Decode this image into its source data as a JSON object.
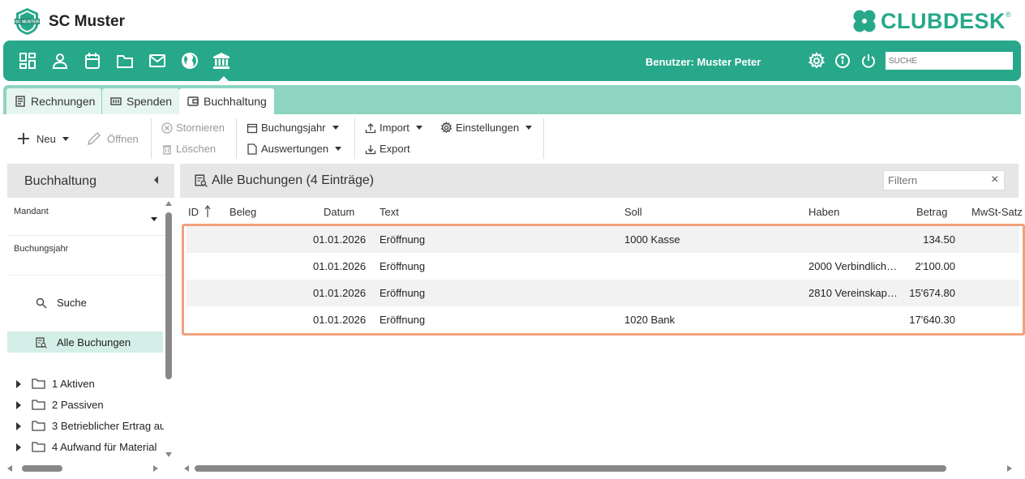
{
  "brand": {
    "club_name": "SC Muster",
    "badge_text": "SC MUSTER",
    "product_name": "CLUBDESK",
    "product_mark": "®",
    "accent_color": "#27a88a"
  },
  "navbar": {
    "icons": [
      "dashboard-icon",
      "person-icon",
      "calendar-icon",
      "folder-icon",
      "mail-icon",
      "globe-icon",
      "bank-icon"
    ],
    "user_label": "Benutzer: Muster Peter",
    "search_placeholder": "SUCHE"
  },
  "tabs": [
    {
      "label": "Rechnungen",
      "icon": "invoice-icon"
    },
    {
      "label": "Spenden",
      "icon": "donation-icon"
    },
    {
      "label": "Buchhaltung",
      "icon": "wallet-icon",
      "active": true
    }
  ],
  "toolbar": {
    "new_label": "Neu",
    "open_label": "Öffnen",
    "cancel_label": "Stornieren",
    "delete_label": "Löschen",
    "fiscal_year_label": "Buchungsjahr",
    "reports_label": "Auswertungen",
    "import_label": "Import",
    "export_label": "Export",
    "settings_label": "Einstellungen"
  },
  "left_panel": {
    "title": "Buchhaltung",
    "mandant_label": "Mandant",
    "year_label": "Buchungsjahr",
    "search_label": "Suche",
    "all_bookings_label": "Alle Buchungen",
    "tree": [
      "1 Aktiven",
      "2 Passiven",
      "3 Betrieblicher Ertrag au",
      "4 Aufwand für Material"
    ]
  },
  "content": {
    "title": "Alle Buchungen (4 Einträge)",
    "filter_placeholder": "Filtern",
    "clear_icon": "×",
    "columns": [
      "ID",
      "Beleg",
      "Datum",
      "Text",
      "Soll",
      "Haben",
      "Betrag",
      "MwSt-Satz"
    ],
    "rows": [
      {
        "datum": "01.01.2026",
        "text": "Eröffnung",
        "soll": "1000 Kasse",
        "haben": "",
        "betrag": "134.50"
      },
      {
        "datum": "01.01.2026",
        "text": "Eröffnung",
        "soll": "",
        "haben": "2000 Verbindlich…",
        "betrag": "2'100.00"
      },
      {
        "datum": "01.01.2026",
        "text": "Eröffnung",
        "soll": "",
        "haben": "2810 Vereinskap…",
        "betrag": "15'674.80"
      },
      {
        "datum": "01.01.2026",
        "text": "Eröffnung",
        "soll": "1020 Bank",
        "haben": "",
        "betrag": "17'640.30"
      }
    ]
  }
}
